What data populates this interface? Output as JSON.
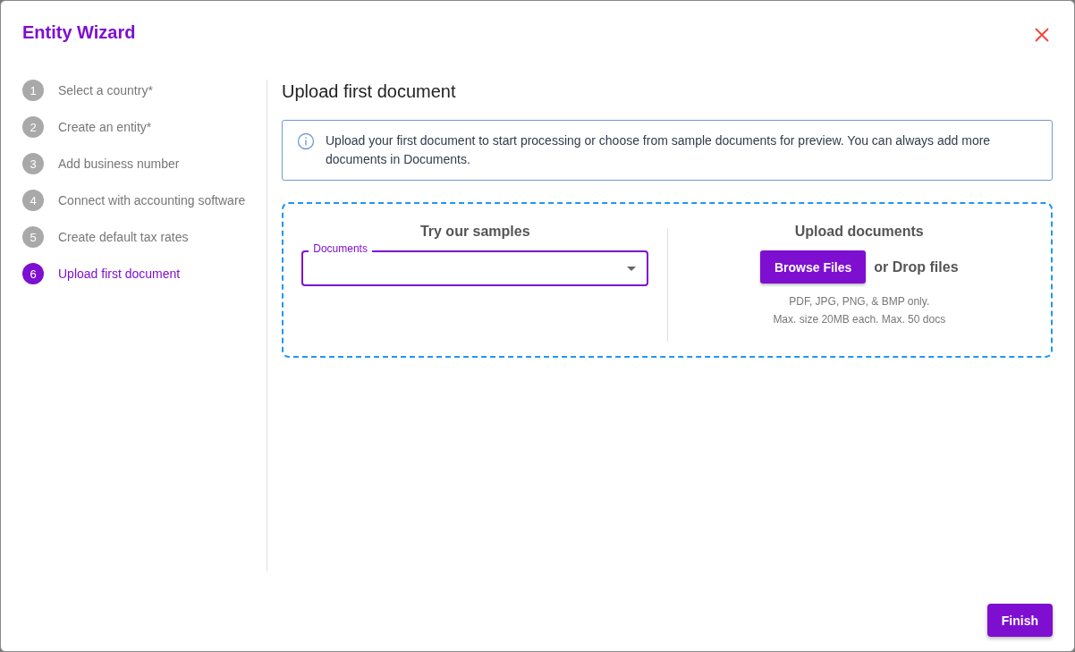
{
  "dialog": {
    "title": "Entity Wizard"
  },
  "steps": [
    {
      "number": "1",
      "label": "Select a country*",
      "selected": false
    },
    {
      "number": "2",
      "label": "Create an entity*",
      "selected": false
    },
    {
      "number": "3",
      "label": "Add business number",
      "selected": false
    },
    {
      "number": "4",
      "label": "Connect with accounting software",
      "selected": false
    },
    {
      "number": "5",
      "label": "Create default tax rates",
      "selected": false
    },
    {
      "number": "6",
      "label": "Upload first document",
      "selected": true
    }
  ],
  "content": {
    "heading": "Upload first document",
    "info": "Upload your first document to start processing or choose from sample documents for preview. You can always add more documents in Documents.",
    "samples": {
      "heading": "Try our samples",
      "select_label": "Documents"
    },
    "upload": {
      "heading": "Upload documents",
      "button": "Browse Files",
      "drop_text": "or Drop files",
      "hint_lines": [
        "PDF, JPG, PNG, & BMP only.",
        "Max. size 20MB each. Max. 50 docs"
      ]
    }
  },
  "footer": {
    "button": "Finish"
  }
}
